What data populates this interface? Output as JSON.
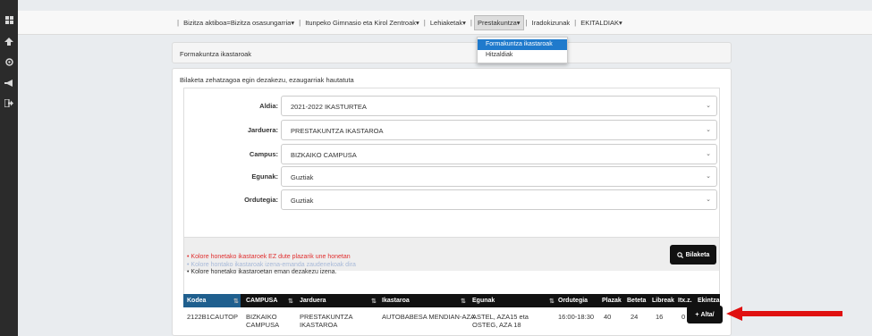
{
  "sidebar": {
    "icons": [
      "grid-icon",
      "user-pin-icon",
      "settings-icon",
      "megaphone-icon",
      "logout-icon"
    ]
  },
  "navbar": {
    "items": [
      {
        "label": "Bizitza aktiboa=Bizitza osasungarria",
        "has_caret": true
      },
      {
        "label": "Itunpeko Gimnasio eta Kirol Zentroak",
        "has_caret": true
      },
      {
        "label": "Lehiaketak",
        "has_caret": true
      },
      {
        "label": "Prestakuntza",
        "has_caret": true,
        "active": true
      },
      {
        "label": "Iradokizunak",
        "has_caret": false
      },
      {
        "label": "EKITALDIAK",
        "has_caret": true
      }
    ],
    "dropdown": [
      "Formakuntza ikastaroak",
      "Hitzaldiak"
    ]
  },
  "panel": {
    "title": "Formakuntza ikastaroak",
    "hint": "Bilaketa zehatzagoa egin dezakezu, ezaugarriak hautatuta"
  },
  "form": {
    "fields": [
      {
        "label": "Aldia:",
        "value": "2021-2022 IKASTURTEA"
      },
      {
        "label": "Jarduera:",
        "value": "PRESTAKUNTZA IKASTAROA"
      },
      {
        "label": "Campus:",
        "value": "BIZKAIKO CAMPUSA"
      },
      {
        "label": "Egunak:",
        "value": "Guztiak"
      },
      {
        "label": "Ordutegia:",
        "value": "Guztiak"
      }
    ],
    "search_label": "Bilaketa"
  },
  "legend": [
    "Kolore honetako ikastaroek EZ dute plazarik une honetan",
    "Kolore hontako ikastaroak izena-emanda zaudenekoak dira",
    "Kolore honetako ikastaroetan eman dezakezu izena."
  ],
  "colors": {
    "accent": "#1f7acc",
    "legend_red": "#e03030",
    "legend_light": "#a7b9d8",
    "arrow": "#e01010"
  },
  "table": {
    "headers": [
      "Kodea",
      "CAMPUSA",
      "Jarduera",
      "Ikastaroa",
      "Egunak",
      "Ordutegia",
      "Plazak",
      "Beteta",
      "Libreak",
      "Itx.z.",
      "Ekintzak"
    ],
    "rows": [
      {
        "kodea": "2122B1CAUTOP",
        "campusa": [
          "BIZKAIKO",
          "CAMPUSA"
        ],
        "jarduera": [
          "PRESTAKUNTZA",
          "IKASTAROA"
        ],
        "ikastaroa": "AUTOBABESA MENDIAN-AZA",
        "egunak": [
          "ASTEL, AZA15 eta",
          "OSTEG, AZA 18"
        ],
        "ordutegia": "16:00-18:30",
        "plazak": "40",
        "beteta": "24",
        "libreak": "16",
        "itxz": "0",
        "action": "Alta/"
      }
    ]
  }
}
